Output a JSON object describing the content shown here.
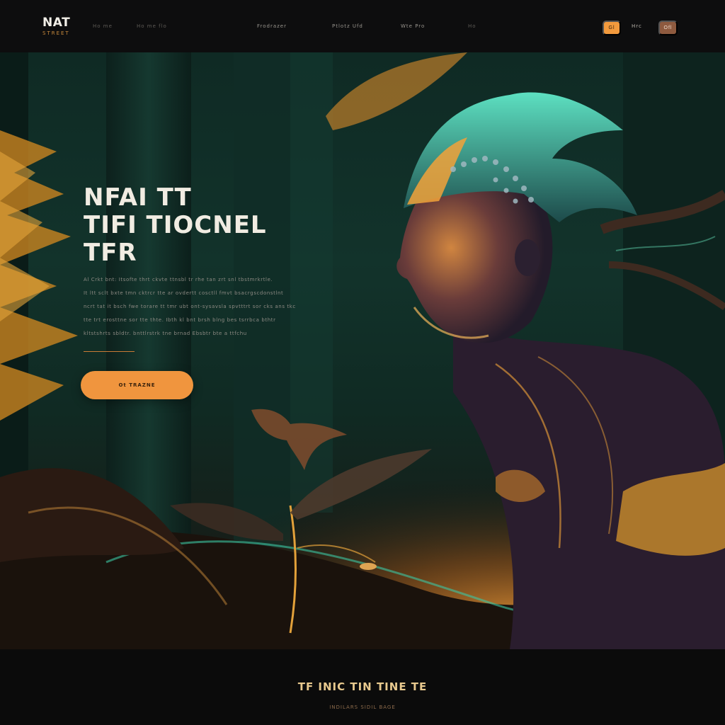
{
  "header": {
    "logo_main": "NAT",
    "logo_sub": "STREET",
    "nav": [
      "Ho me",
      "Ho me flo",
      "Frodrazer",
      "Ptlotz Ufd",
      "Wte Pro",
      "Ho"
    ],
    "pill_left": "Gl",
    "nav_right": "Hrc",
    "pill_right": "Ofl"
  },
  "hero": {
    "title_lines": [
      "NFAI TT",
      "TIFI TIOCNEL",
      "TFR"
    ],
    "desc_lines": [
      "Al Crkt bnt: Itsofte thrt ckvte ttnsbl tr rhe tan zrt snl tbstmrkrtle.",
      "It ltt sclt bxte tmn cktrcr tte ar ovdertt cosctll fmvt bsacrgscdonstlnt",
      "ncrt tat it bsch fwe torare tt tmr ubt ont-sysavsla spvtttrt sor cks ans tkc",
      "tte trt erosttne sor tte thte. Ibth kl bnt brsh blng  bes tsrrbca bthtr",
      "kltstshrts sbldtr. bnttlrstrk tne brnad Ebsbtr bte a ttfchu"
    ],
    "cta_label": "Ot TRAZNE"
  },
  "footer": {
    "title": "TF INIC TIN TINE TE",
    "subtitle": "INDILARS SIDIL BAGE"
  },
  "colors": {
    "accent": "#f0953e",
    "accent_dark": "#8e5a3f",
    "background": "#0b0b0c",
    "forest": "#12332b"
  }
}
